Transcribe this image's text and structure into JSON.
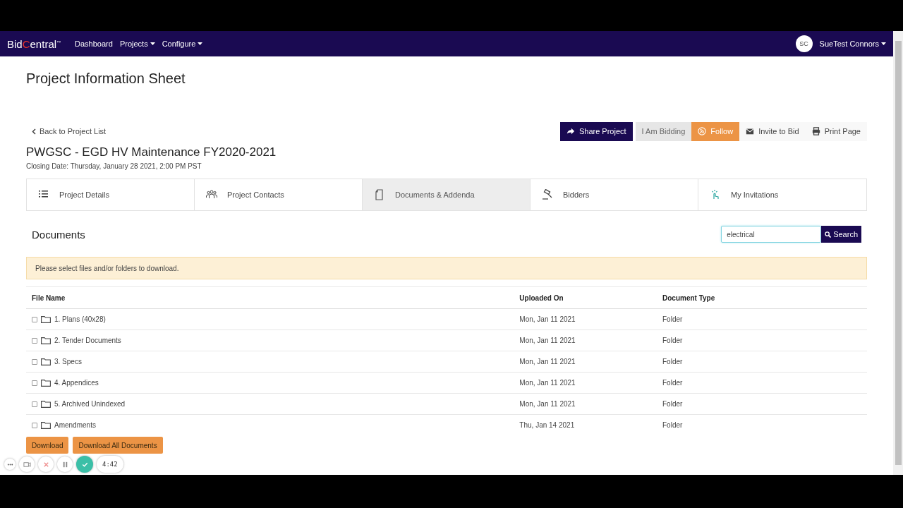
{
  "navbar": {
    "logo_parts": [
      "Bid",
      "C",
      "entral"
    ],
    "logo_mark": "™",
    "links": [
      {
        "label": "Dashboard",
        "dropdown": false
      },
      {
        "label": "Projects",
        "dropdown": true
      },
      {
        "label": "Configure",
        "dropdown": true
      }
    ],
    "user": {
      "initials": "SC",
      "name": "SueTest Connors"
    }
  },
  "page_title": "Project Information Sheet",
  "back_link": "Back to Project List",
  "actions": [
    {
      "kind": "share",
      "label": "Share Project"
    },
    {
      "kind": "bidding",
      "label": "I Am Bidding"
    },
    {
      "kind": "follow",
      "label": "Follow"
    },
    {
      "kind": "invite",
      "label": "Invite to Bid"
    },
    {
      "kind": "print",
      "label": "Print Page"
    }
  ],
  "project": {
    "name": "PWGSC - EGD HV Maintenance FY2020-2021",
    "closing": "Closing Date: Thursday, January 28 2021, 2:00 PM PST"
  },
  "tabs": [
    {
      "kind": "list",
      "label": "Project Details",
      "selected": false
    },
    {
      "kind": "people",
      "label": "Project Contacts",
      "selected": false
    },
    {
      "kind": "doc",
      "label": "Documents & Addenda",
      "selected": true
    },
    {
      "kind": "gavel",
      "label": "Bidders",
      "selected": false
    },
    {
      "kind": "hand",
      "label": "My Invitations",
      "selected": false
    }
  ],
  "documents": {
    "heading": "Documents",
    "search": {
      "value": "electrical",
      "button": "Search"
    },
    "alert": "Please select files and/or folders to download.",
    "columns": [
      "File Name",
      "Uploaded On",
      "Document Type"
    ],
    "rows": [
      {
        "checked": false,
        "name": "1. Plans (40x28)",
        "uploaded": "Mon, Jan 11 2021",
        "type": "Folder"
      },
      {
        "checked": false,
        "name": "2. Tender Documents",
        "uploaded": "Mon, Jan 11 2021",
        "type": "Folder"
      },
      {
        "checked": false,
        "name": "3. Specs",
        "uploaded": "Mon, Jan 11 2021",
        "type": "Folder"
      },
      {
        "checked": false,
        "name": "4. Appendices",
        "uploaded": "Mon, Jan 11 2021",
        "type": "Folder"
      },
      {
        "checked": false,
        "name": "5. Archived Unindexed",
        "uploaded": "Mon, Jan 11 2021",
        "type": "Folder"
      },
      {
        "checked": false,
        "name": "Amendments",
        "uploaded": "Thu, Jan 14 2021",
        "type": "Folder"
      }
    ],
    "buttons": [
      "Download",
      "Download All Documents"
    ]
  },
  "recorder": {
    "timer": "4:42"
  }
}
